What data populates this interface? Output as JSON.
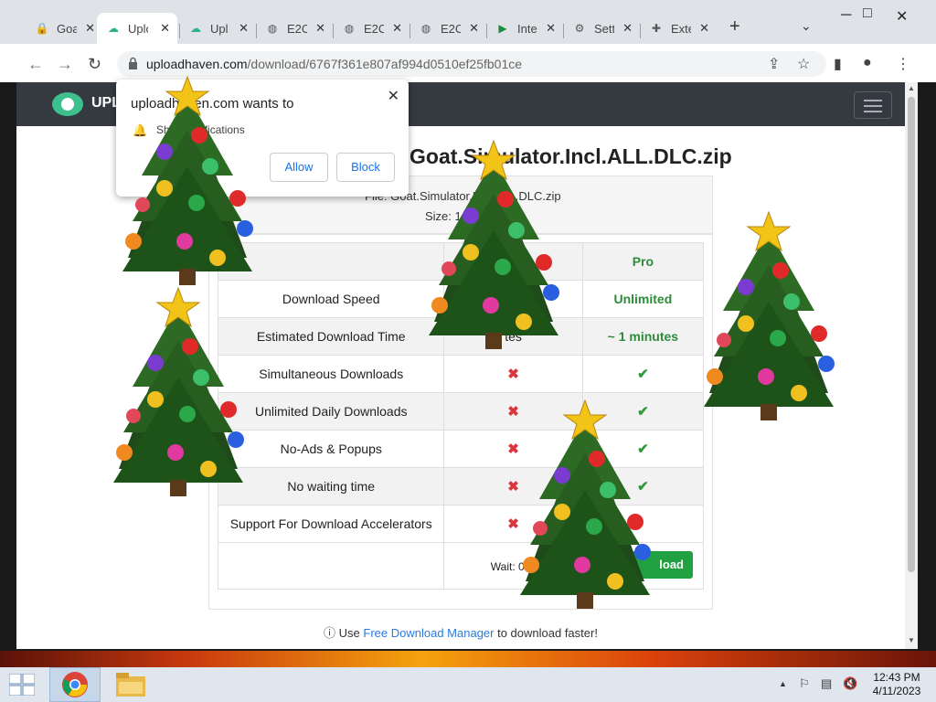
{
  "browser": {
    "tabs": [
      {
        "title": "Goa",
        "icon": "lock-icon",
        "color": "#d93025"
      },
      {
        "title": "Uplo",
        "icon": "cloud-icon",
        "color": "#2db08a",
        "active": true
      },
      {
        "title": "Upl",
        "icon": "cloud-icon",
        "color": "#2db08a"
      },
      {
        "title": "E2C",
        "icon": "globe-icon",
        "color": "#555555"
      },
      {
        "title": "E2C",
        "icon": "globe-icon",
        "color": "#555555"
      },
      {
        "title": "E2C",
        "icon": "globe-icon",
        "color": "#555555"
      },
      {
        "title": "Inte",
        "icon": "play-icon",
        "color": "#1e8e3e"
      },
      {
        "title": "Sett",
        "icon": "gear-icon",
        "color": "#555555"
      },
      {
        "title": "Exte",
        "icon": "puzzle-icon",
        "color": "#555555"
      }
    ],
    "url_host": "uploadhaven.com",
    "url_path": "/download/6767f361e807af994d0510ef25fb01ce"
  },
  "popup": {
    "title": "uploadhaven.com wants to",
    "permission": "Show notifications",
    "allow_label": "Allow",
    "block_label": "Block"
  },
  "site": {
    "logo_text": "UPL",
    "file_title": "Goat.Simulator.Incl.ALL.DLC.zip",
    "file_line": "File: Goat.Simulator.Incl.ALL.DLC.zip",
    "size_line": "Size: 1"
  },
  "table": {
    "header": {
      "free": "",
      "pro": "Pro"
    },
    "rows": [
      {
        "feature": "Download Speed",
        "free": "",
        "pro": "Unlimited",
        "type": "text"
      },
      {
        "feature": "Estimated Download Time",
        "free": "tes",
        "pro": "~ 1 minutes",
        "type": "text"
      },
      {
        "feature": "Simultaneous Downloads",
        "free": "✖",
        "pro": "✔",
        "type": "mark"
      },
      {
        "feature": "Unlimited Daily Downloads",
        "free": "✖",
        "pro": "✔",
        "type": "mark"
      },
      {
        "feature": "No-Ads & Popups",
        "free": "✖",
        "pro": "✔",
        "type": "mark"
      },
      {
        "feature": "No waiting time",
        "free": "✖",
        "pro": "✔",
        "type": "mark"
      },
      {
        "feature": "Support For Download Accelerators",
        "free": "✖",
        "pro": "",
        "type": "mark"
      }
    ],
    "wait_label": "Wait: 05s",
    "download_label": "load"
  },
  "tip": {
    "prefix": "Use ",
    "link": "Free Download Manager",
    "suffix": " to download faster!"
  },
  "taskbar": {
    "time": "12:43 PM",
    "date": "4/11/2023"
  },
  "colors": {
    "accent_green": "#21a041",
    "nav_dark": "#353a40",
    "link_blue": "#2a7ae2"
  }
}
